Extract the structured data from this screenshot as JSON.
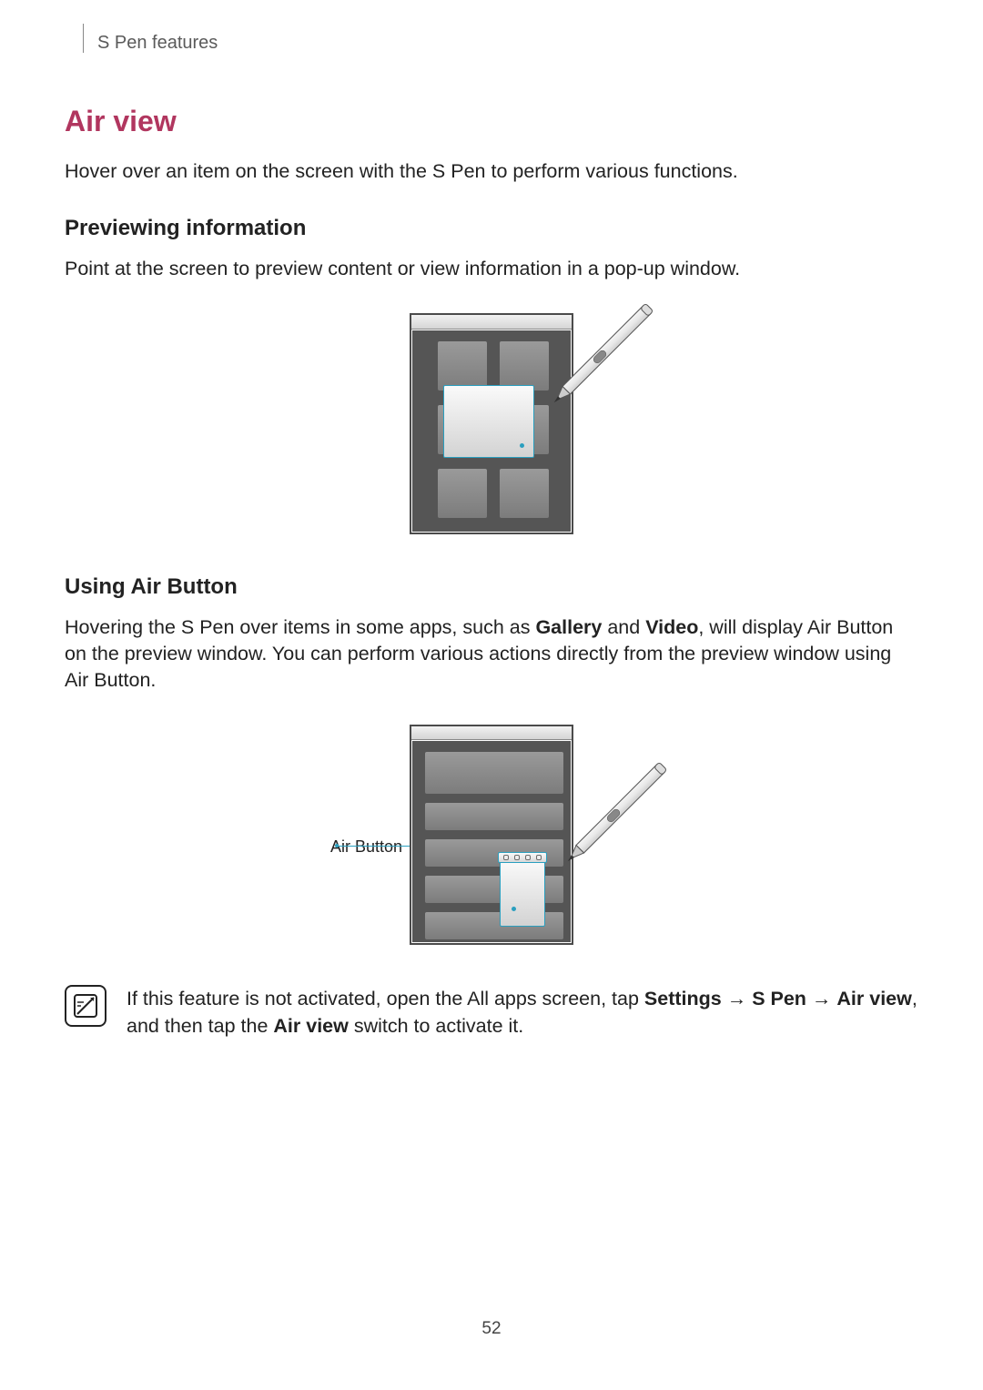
{
  "header": {
    "breadcrumb": "S Pen features"
  },
  "section": {
    "title": "Air view",
    "intro": "Hover over an item on the screen with the S Pen to perform various functions."
  },
  "preview": {
    "heading": "Previewing information",
    "text": "Point at the screen to preview content or view information in a pop-up window."
  },
  "airbutton": {
    "heading": "Using Air Button",
    "text_before": "Hovering the S Pen over items in some apps, such as ",
    "bold1": "Gallery",
    "text_mid1": " and ",
    "bold2": "Video",
    "text_after": ", will display Air Button on the preview window. You can perform various actions directly from the preview window using Air Button.",
    "callout": "Air Button"
  },
  "note": {
    "text_before": "If this feature is not activated, open the All apps screen, tap ",
    "bold1": "Settings",
    "arrow1": " → ",
    "bold2": "S Pen",
    "arrow2": " → ",
    "bold3": "Air view",
    "text_mid": ", and then tap the ",
    "bold4": "Air view",
    "text_after": " switch to activate it."
  },
  "page_number": "52"
}
